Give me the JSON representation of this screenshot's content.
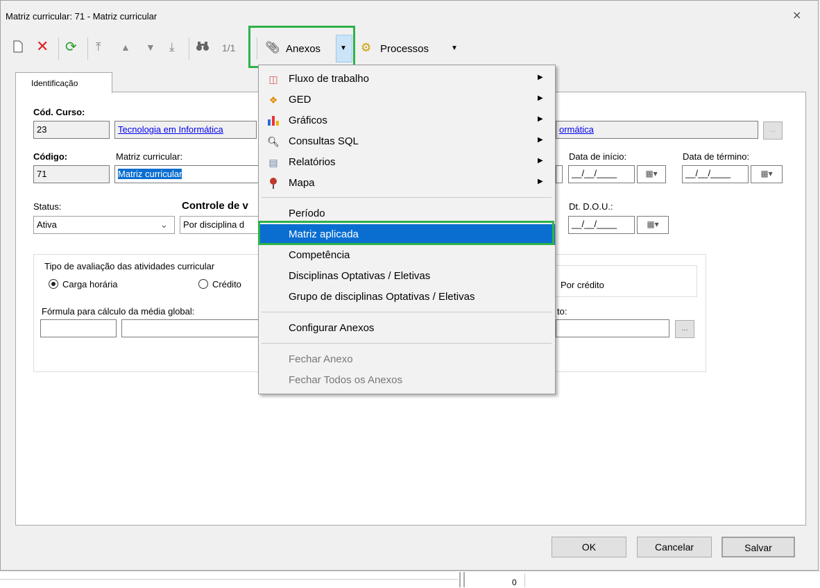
{
  "window": {
    "title": "Matriz curricular: 71 - Matriz curricular",
    "close_glyph": "⨯"
  },
  "toolbar": {
    "record_counter": "1/1",
    "anexos_label": "Anexos",
    "processos_label": "Processos"
  },
  "tab": {
    "label": "Identificação"
  },
  "form": {
    "cod_curso_label": "Cód. Curso:",
    "cod_curso_value": "23",
    "curso_name": "Tecnologia em Informática",
    "curso_name_right": "ormática",
    "browse": "...",
    "codigo_label": "Código:",
    "codigo_value": "71",
    "matriz_label": "Matriz curricular:",
    "matriz_value": "Matriz curricular",
    "data_inicio_label": "Data de início:",
    "data_termino_label": "Data de término:",
    "date_placeholder": "__/__/____",
    "status_label": "Status:",
    "status_value": "Ativa",
    "controle_label": "Controle de v",
    "controle_value": "Por disciplina d",
    "dou_label": "Dt. D.O.U.:",
    "group_label": "Tipo de avaliação das atividades curricular",
    "radio_carga": "Carga horária",
    "radio_credito": "Crédito",
    "radio_por_credito": "Por crédito",
    "formula_label": "Fórmula para cálculo da média global:",
    "formula_right_label": "to:"
  },
  "buttons": {
    "ok": "OK",
    "cancelar": "Cancelar",
    "salvar": "Salvar"
  },
  "menu": {
    "items": [
      {
        "label": "Fluxo de trabalho",
        "icon": "workflow-icon",
        "submenu": true
      },
      {
        "label": "GED",
        "icon": "ged-icon",
        "submenu": true
      },
      {
        "label": "Gráficos",
        "icon": "chart-icon",
        "submenu": true
      },
      {
        "label": "Consultas SQL",
        "icon": "sql-query-icon",
        "submenu": true
      },
      {
        "label": "Relatórios",
        "icon": "report-icon",
        "submenu": true
      },
      {
        "label": "Mapa",
        "icon": "map-pin-icon",
        "submenu": true
      },
      {
        "label": "Período"
      },
      {
        "label": "Matriz aplicada",
        "selected": true
      },
      {
        "label": "Competência"
      },
      {
        "label": "Disciplinas Optativas / Eletivas"
      },
      {
        "label": "Grupo de disciplinas Optativas / Eletivas"
      },
      {
        "label": "Configurar Anexos"
      },
      {
        "label": "Fechar Anexo",
        "disabled": true
      },
      {
        "label": "Fechar Todos os Anexos",
        "disabled": true
      }
    ]
  },
  "statusbar": {
    "value": "0"
  },
  "colors": {
    "highlight": "#2db24a",
    "menu_selected": "#0a6ed1",
    "link": "#0000ee"
  }
}
